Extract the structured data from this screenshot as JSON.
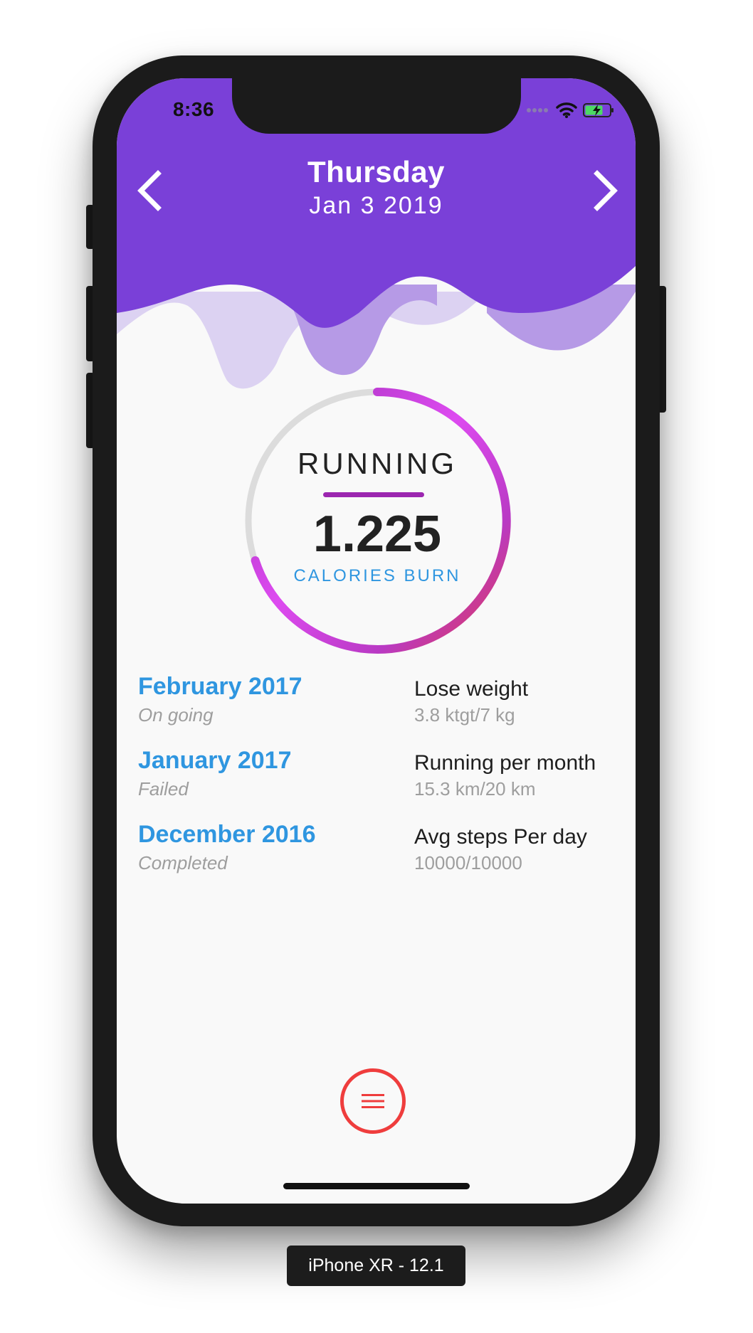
{
  "status_bar": {
    "time": "8:36",
    "icons": [
      "signal-icon",
      "wifi-icon",
      "battery-charging-icon"
    ]
  },
  "header": {
    "day": "Thursday",
    "date": "Jan 3 2019",
    "prev_icon": "chevron-left-icon",
    "next_icon": "chevron-right-icon",
    "color": "#7a40d8"
  },
  "activity": {
    "label": "RUNNING",
    "value": "1.225",
    "unit": "CALORIES BURN"
  },
  "goals": [
    {
      "month": "February 2017",
      "status": "On going",
      "name": "Lose weight",
      "progress": "3.8 ktgt/7 kg"
    },
    {
      "month": "January 2017",
      "status": "Failed",
      "name": "Running per month",
      "progress": "15.3 km/20 km"
    },
    {
      "month": "December 2016",
      "status": "Completed",
      "name": "Avg steps Per day",
      "progress": "10000/10000"
    }
  ],
  "menu": {
    "icon": "menu-icon",
    "color": "#ef3d3d"
  },
  "device_label": "iPhone XR - 12.1"
}
